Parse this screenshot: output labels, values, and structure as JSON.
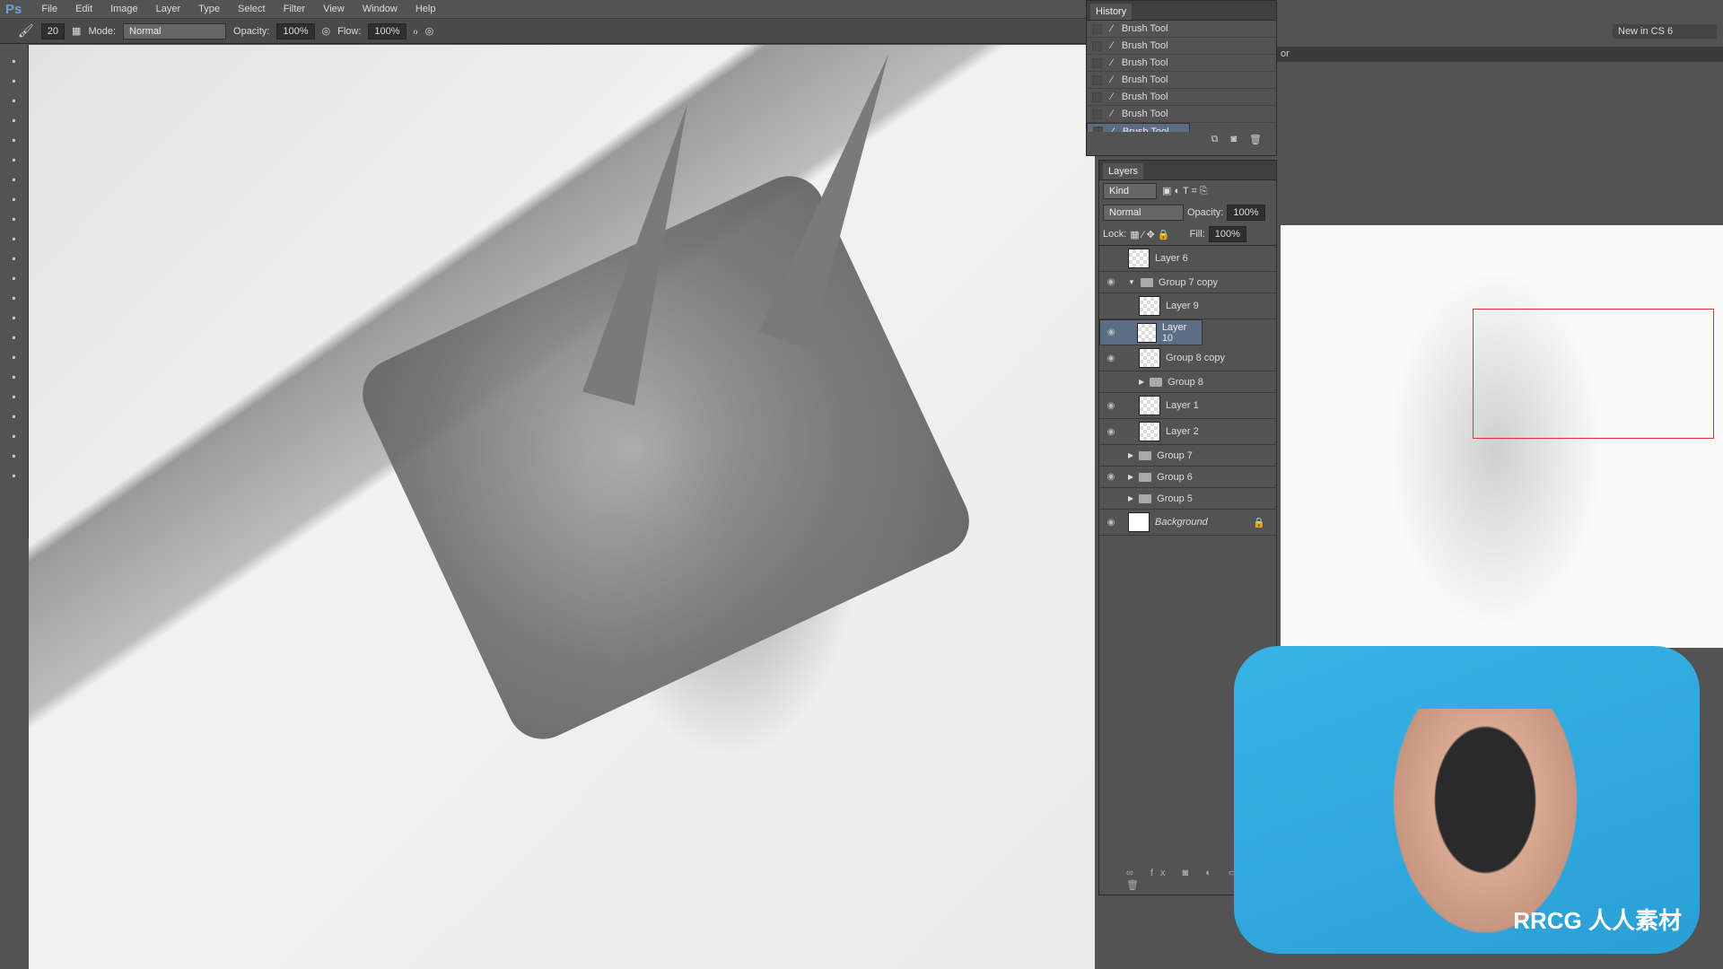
{
  "menu": {
    "logo": "Ps",
    "items": [
      "File",
      "Edit",
      "Image",
      "Layer",
      "Type",
      "Select",
      "Filter",
      "View",
      "Window",
      "Help"
    ]
  },
  "options": {
    "brush_size": "20",
    "mode_label": "Mode:",
    "mode": "Normal",
    "opacity_label": "Opacity:",
    "opacity": "100%",
    "flow_label": "Flow:",
    "flow": "100%"
  },
  "workspace": {
    "selector": "New in CS 6",
    "partial_tab": "or"
  },
  "history": {
    "title": "History",
    "items": [
      "Brush Tool",
      "Brush Tool",
      "Brush Tool",
      "Brush Tool",
      "Brush Tool",
      "Brush Tool",
      "Brush Tool"
    ],
    "selected_index": 6
  },
  "layers": {
    "title": "Layers",
    "filter": "Kind",
    "blend": "Normal",
    "opacity_label": "Opacity:",
    "opacity": "100%",
    "lock_label": "Lock:",
    "fill_label": "Fill:",
    "fill": "100%",
    "items": [
      {
        "name": "Layer 6",
        "type": "layer",
        "visible": false,
        "indent": 0
      },
      {
        "name": "Group 7 copy",
        "type": "group-open",
        "visible": true,
        "indent": 0
      },
      {
        "name": "Layer 9",
        "type": "layer",
        "visible": false,
        "indent": 1
      },
      {
        "name": "Layer 10",
        "type": "layer",
        "visible": true,
        "indent": 1,
        "selected": true
      },
      {
        "name": "Group 8 copy",
        "type": "layer",
        "visible": true,
        "indent": 1
      },
      {
        "name": "Group 8",
        "type": "group",
        "visible": false,
        "indent": 1
      },
      {
        "name": "Layer 1",
        "type": "layer",
        "visible": true,
        "indent": 1
      },
      {
        "name": "Layer 2",
        "type": "layer",
        "visible": true,
        "indent": 1
      },
      {
        "name": "Group 7",
        "type": "group",
        "visible": false,
        "indent": 0
      },
      {
        "name": "Group 6",
        "type": "group",
        "visible": true,
        "indent": 0
      },
      {
        "name": "Group 5",
        "type": "group",
        "visible": false,
        "indent": 0
      },
      {
        "name": "Background",
        "type": "background",
        "visible": true,
        "indent": 0,
        "locked": true
      }
    ]
  },
  "watermark": {
    "text": "RRCG 人人素材"
  },
  "colors": {
    "accent_selected": "#5c6c82",
    "navigator_frame": "#e03030",
    "webcam_bg": "#2fa8de"
  }
}
